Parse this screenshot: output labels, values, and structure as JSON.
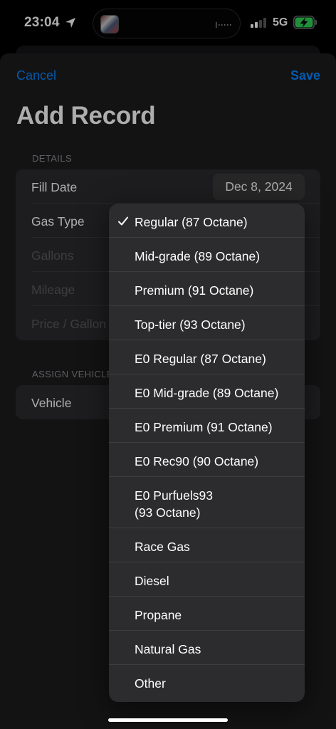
{
  "status": {
    "time": "23:04",
    "network": "5G"
  },
  "nav": {
    "cancel_label": "Cancel",
    "save_label": "Save",
    "title": "Add Record"
  },
  "details": {
    "header": "DETAILS",
    "fill_date_label": "Fill Date",
    "fill_date_value": "Dec 8, 2024",
    "gas_type_label": "Gas Type",
    "gallons_label": "Gallons",
    "mileage_label": "Mileage",
    "price_label": "Price / Gallon"
  },
  "vehicle": {
    "header": "ASSIGN VEHICLE",
    "vehicle_label": "Vehicle"
  },
  "gas_types": {
    "selected": "Regular (87 Octane)",
    "options": [
      "Regular (87 Octane)",
      "Mid-grade (89 Octane)",
      "Premium (91 Octane)",
      "Top-tier (93 Octane)",
      "E0 Regular (87 Octane)",
      "E0 Mid-grade (89 Octane)",
      "E0 Premium (91 Octane)",
      "E0 Rec90 (90 Octane)",
      "E0 Purfuels93 (93 Octane)",
      "Race Gas",
      "Diesel",
      "Propane",
      "Natural Gas",
      "Other"
    ]
  },
  "colors": {
    "accent": "#0a84ff",
    "sheet": "#1c1c1e",
    "cell": "#2c2c2e"
  },
  "icons": {
    "location": "location-arrow-icon",
    "signal": "cellular-signal-icon",
    "battery": "battery-charging-icon",
    "check": "checkmark-icon"
  }
}
